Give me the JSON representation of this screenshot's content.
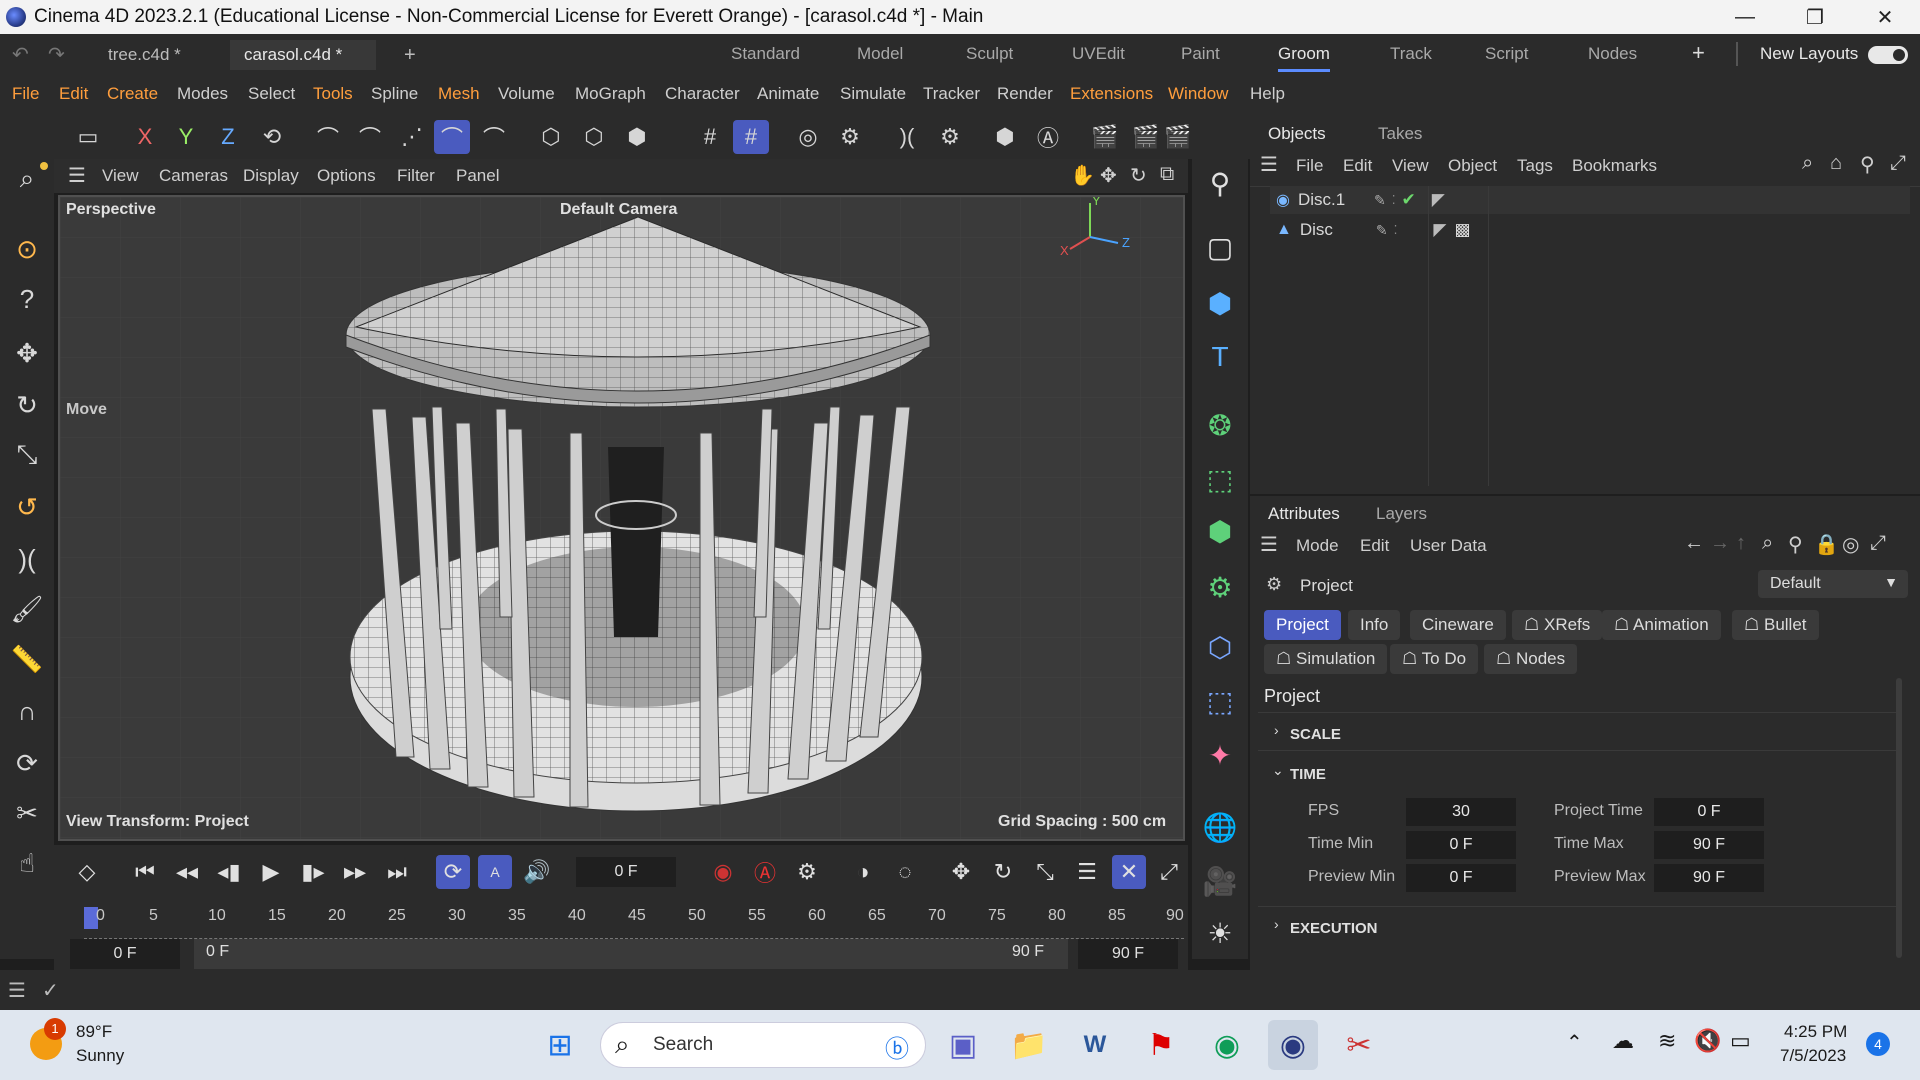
{
  "window": {
    "title": "Cinema 4D 2023.2.1 (Educational License - Non-Commercial License for Everett Orange) - [carasol.c4d *] - Main",
    "controls": [
      "—",
      "❐",
      "✕"
    ]
  },
  "doc_tabs": [
    {
      "label": "tree.c4d *"
    },
    {
      "label": "carasol.c4d *",
      "close": "✕"
    },
    {
      "label": "+"
    }
  ],
  "layouts": [
    "Standard",
    "Model",
    "Sculpt",
    "UVEdit",
    "Paint",
    "Groom",
    "Track",
    "Script",
    "Nodes",
    "+"
  ],
  "layout_active": "Groom",
  "new_layouts_label": "New Layouts",
  "menu": [
    "File",
    "Edit",
    "Create",
    "Modes",
    "Select",
    "Tools",
    "Spline",
    "Mesh",
    "Volume",
    "MoGraph",
    "Character",
    "Animate",
    "Simulate",
    "Tracker",
    "Render",
    "Extensions",
    "Window",
    "Help"
  ],
  "toolbar": {
    "x_label": "X",
    "y_label": "Y",
    "z_label": "Z"
  },
  "viewport": {
    "menu": [
      "View",
      "Cameras",
      "Display",
      "Options",
      "Filter",
      "Panel"
    ],
    "perspective_label": "Perspective",
    "camera_label": "Default Camera",
    "move_label": "Move",
    "view_transform": "View Transform: Project",
    "grid_spacing": "Grid Spacing : 500 cm",
    "axis": {
      "x": "X",
      "y": "Y",
      "z": "Z"
    }
  },
  "timeline": {
    "current_frame": "0 F",
    "ruler_ticks": [
      "0",
      "5",
      "10",
      "15",
      "20",
      "25",
      "30",
      "35",
      "40",
      "45",
      "50",
      "55",
      "60",
      "65",
      "70",
      "75",
      "80",
      "85",
      "90"
    ],
    "start_field": "0 F",
    "range_start": "0 F",
    "range_end": "90 F",
    "end_field": "90 F"
  },
  "objects_panel": {
    "tabs": [
      "Objects",
      "Takes"
    ],
    "menu": [
      "File",
      "Edit",
      "View",
      "Object",
      "Tags",
      "Bookmarks"
    ],
    "items": [
      {
        "name": "Disc.1",
        "icon": "disc-icon"
      },
      {
        "name": "Disc",
        "icon": "cone-icon"
      }
    ]
  },
  "attributes_panel": {
    "tabs": [
      "Attributes",
      "Layers"
    ],
    "menu": [
      "Mode",
      "Edit",
      "User Data"
    ],
    "object_label": "Project",
    "preset": "Default",
    "buttons_row1": [
      "Project",
      "Info",
      "Cineware",
      "XRefs",
      "Animation",
      "Bullet"
    ],
    "buttons_row2": [
      "Simulation",
      "To Do",
      "Nodes"
    ],
    "section_title": "Project",
    "groups": {
      "scale": "SCALE",
      "time": "TIME",
      "execution": "EXECUTION"
    },
    "fields": {
      "fps_label": "FPS",
      "fps": "30",
      "project_time_label": "Project Time",
      "project_time": "0 F",
      "time_min_label": "Time Min",
      "time_min": "0 F",
      "time_max_label": "Time Max",
      "time_max": "90 F",
      "preview_min_label": "Preview Min",
      "preview_min": "0 F",
      "preview_max_label": "Preview Max",
      "preview_max": "90 F"
    }
  },
  "taskbar": {
    "weather_temp": "89°F",
    "weather_desc": "Sunny",
    "weather_badge": "1",
    "search_placeholder": "Search",
    "time": "4:25 PM",
    "date": "7/5/2023",
    "notification_count": "4"
  },
  "colors": {
    "accent": "#4a5bbf",
    "orange_menu": "#ff9e3d",
    "active_layout_underline": "#5b8cff"
  }
}
